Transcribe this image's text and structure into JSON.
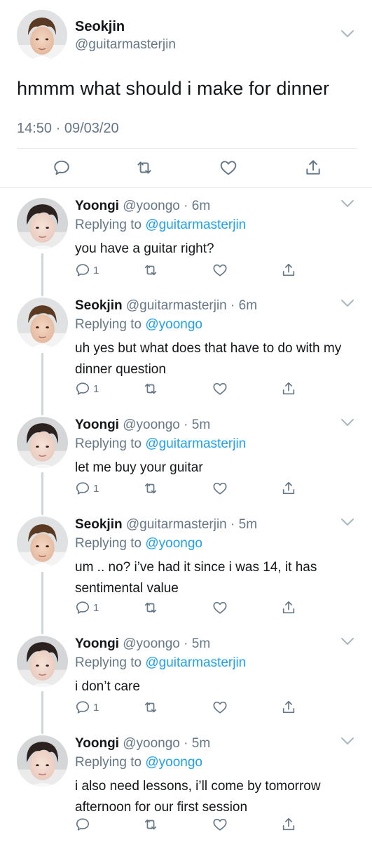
{
  "main_tweet": {
    "name": "Seokjin",
    "handle": "@guitarmasterjin",
    "text": "hmmm what should i make for dinner",
    "timestamp": "14:50 · 09/03/20"
  },
  "replies": [
    {
      "name": "Yoongi",
      "handle": "@yoongo",
      "time": "6m",
      "replying_prefix": "Replying to ",
      "replying_to": "@guitarmasterjin",
      "text": "you have a guitar right?",
      "reply_count": "1"
    },
    {
      "name": "Seokjin",
      "handle": "@guitarmasterjin",
      "time": "6m",
      "replying_prefix": "Replying to ",
      "replying_to": "@yoongo",
      "text": "uh yes but what does that have to do with my dinner question",
      "reply_count": "1"
    },
    {
      "name": "Yoongi",
      "handle": "@yoongo",
      "time": "5m",
      "replying_prefix": "Replying to ",
      "replying_to": "@guitarmasterjin",
      "text": "let me buy your guitar",
      "reply_count": "1"
    },
    {
      "name": "Seokjin",
      "handle": "@guitarmasterjin",
      "time": "5m",
      "replying_prefix": "Replying to ",
      "replying_to": "@yoongo",
      "text": "um .. no? i’ve had it since i was 14, it has sentimental value",
      "reply_count": "1"
    },
    {
      "name": "Yoongi",
      "handle": "@yoongo",
      "time": "5m",
      "replying_prefix": "Replying to ",
      "replying_to": "@guitarmasterjin",
      "text": "i don’t care",
      "reply_count": "1"
    },
    {
      "name": "Yoongi",
      "handle": "@yoongo",
      "time": "5m",
      "replying_prefix": "Replying to ",
      "replying_to": "@yoongo",
      "text": "i also need lessons, i’ll come by tomorrow afternoon for our first session",
      "reply_count": ""
    }
  ],
  "colors": {
    "text": "#14171a",
    "secondary": "#657786",
    "link": "#1da1f2",
    "divider": "#e6ecf0",
    "thread_line": "#ccd6dd"
  },
  "icons": [
    "avatar-photo",
    "chevron-down-icon",
    "reply-icon",
    "retweet-icon",
    "like-icon",
    "share-icon"
  ]
}
